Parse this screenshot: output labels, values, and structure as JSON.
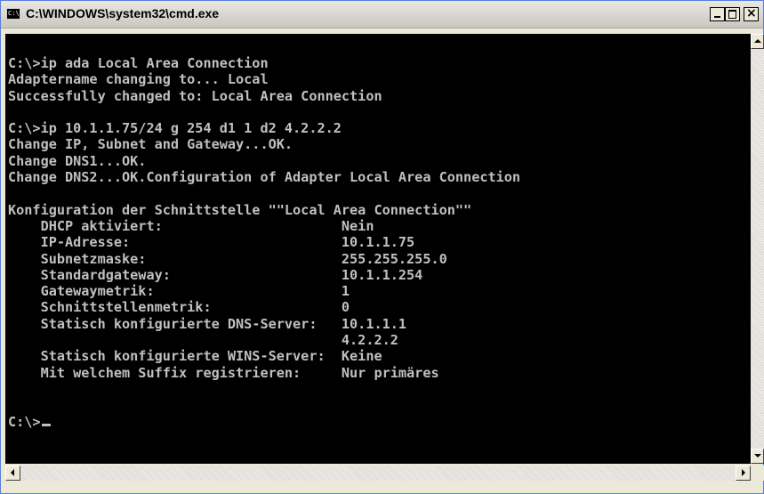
{
  "window": {
    "title": "C:\\WINDOWS\\system32\\cmd.exe",
    "icon_label": "C:\\",
    "close_glyph": "×"
  },
  "console": {
    "lines": [
      "C:\\>ip ada Local Area Connection",
      "Adaptername changing to... Local",
      "Successfully changed to: Local Area Connection",
      "",
      "C:\\>ip 10.1.1.75/24 g 254 d1 1 d2 4.2.2.2",
      "Change IP, Subnet and Gateway...OK.",
      "Change DNS1...OK.",
      "Change DNS2...OK.Configuration of Adapter Local Area Connection",
      "",
      "Konfiguration der Schnittstelle \"\"Local Area Connection\"\"",
      "    DHCP aktiviert:                      Nein",
      "    IP-Adresse:                          10.1.1.75",
      "    Subnetzmaske:                        255.255.255.0",
      "    Standardgateway:                     10.1.1.254",
      "    Gatewaymetrik:                       1",
      "    Schnittstellenmetrik:                0",
      "    Statisch konfigurierte DNS-Server:   10.1.1.1",
      "                                         4.2.2.2",
      "    Statisch konfigurierte WINS-Server:  Keine",
      "    Mit welchem Suffix registrieren:     Nur primäres",
      "",
      "",
      "C:\\>"
    ]
  },
  "colors": {
    "console_bg": "#000000",
    "console_text": "#c0c0c0",
    "chrome": "#ece9d8"
  }
}
